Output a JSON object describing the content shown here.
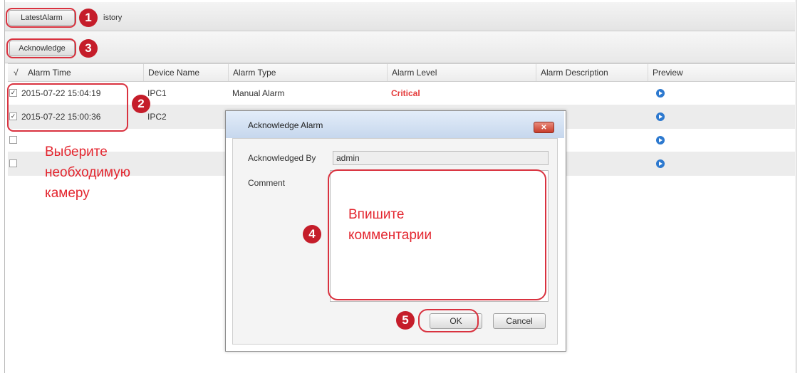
{
  "tabs": {
    "latest_label": "LatestAlarm",
    "history_label": "istory"
  },
  "toolbar": {
    "acknowledge_label": "Acknowledge"
  },
  "table": {
    "headers": [
      "√",
      "Alarm Time",
      "Device Name",
      "Alarm Type",
      "Alarm Level",
      "Alarm Description",
      "Preview"
    ],
    "rows": [
      {
        "checked": "✓",
        "time": "2015-07-22 15:04:19",
        "device": "IPC1",
        "type": "Manual Alarm",
        "level": "Critical",
        "description": ""
      },
      {
        "checked": "✓",
        "time": "2015-07-22 15:00:36",
        "device": "IPC2",
        "type": "",
        "level": "",
        "description": ""
      },
      {
        "checked": "",
        "time": "",
        "device": "",
        "type": "",
        "level": "",
        "description": ""
      },
      {
        "checked": "",
        "time": "",
        "device": "",
        "type": "",
        "level": "",
        "description": ""
      }
    ]
  },
  "dialog": {
    "title": "Acknowledge Alarm",
    "close_label": "✕",
    "ack_by_label": "Acknowledged By",
    "ack_by_value": "admin",
    "comment_label": "Comment",
    "comment_value": "",
    "ok_label": "OK",
    "cancel_label": "Cancel"
  },
  "annotations": {
    "badges": [
      "1",
      "2",
      "3",
      "4",
      "5"
    ],
    "note_select": [
      "Выберите",
      "необходимую",
      "камеру"
    ],
    "note_comment": [
      "Впишите",
      "комментарии"
    ]
  },
  "colors": {
    "critical": "#e43b3b",
    "annotation_red": "#d9323f",
    "badge": "#c51d2a",
    "preview_icon": "#2d79cf"
  },
  "icons": {
    "preview": "play-circle-icon",
    "close": "close-icon"
  }
}
